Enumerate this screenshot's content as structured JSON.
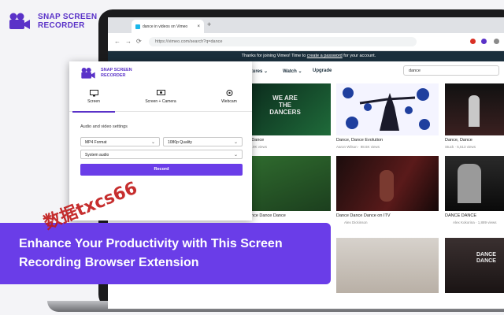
{
  "brand": {
    "line1": "SNAP SCREEN",
    "line2": "RECORDER"
  },
  "browser": {
    "tab_title": "dance in videos on Vimeo",
    "url": "https://vimeo.com/search?q=dance",
    "new_tab": "+",
    "tab_close": "×",
    "back": "←",
    "forward": "→",
    "reload": "⟳"
  },
  "vimeo": {
    "banner_prefix": "Thanks for joining Vimeo! Time to ",
    "banner_link": "create a password",
    "banner_suffix": " for your account.",
    "nav": {
      "features": "eatures ⌄",
      "watch": "Watch ⌄",
      "upgrade": "Upgrade"
    },
    "search_value": "dance",
    "videos": [
      {
        "title": "ce Dance",
        "meta": "· 21.9K views",
        "thumb_text": "WE ARE THE DANCERS"
      },
      {
        "title": "Dance, Dance Evolution",
        "meta": "Aaron Wilson · 98.6K views"
      },
      {
        "title": "Dance, Dance",
        "meta": "Stuck · 5,513 views"
      },
      {
        "title": "Dance Dance Dance",
        "meta": ""
      },
      {
        "title": "Dance Dance Dance on ITV",
        "meta": "Alex Dickinson"
      },
      {
        "title": "DANCE DANCE",
        "meta": "Alex Kokorina · 1,889 views",
        "thumb_text": "DANCE DANCE"
      },
      {
        "thumb_text": "DANCE DANCE"
      }
    ]
  },
  "popup": {
    "brand_line1": "SNAP SCREEN",
    "brand_line2": "RECORDER",
    "tabs": [
      "Screen",
      "Screen + Camera",
      "Webcam"
    ],
    "section_title": "Audio and video settings",
    "format": "MP4 Format",
    "quality": "1080p Quality",
    "audio": "System audio",
    "record": "Record"
  },
  "promo": {
    "line1": "Enhance Your Productivity with This Screen",
    "line2": "Recording Browser Extension"
  },
  "watermark": "数据txcs66",
  "colors": {
    "accent": "#6a3de8",
    "brand": "#5a32c8",
    "banner": "#1a2e3b"
  }
}
